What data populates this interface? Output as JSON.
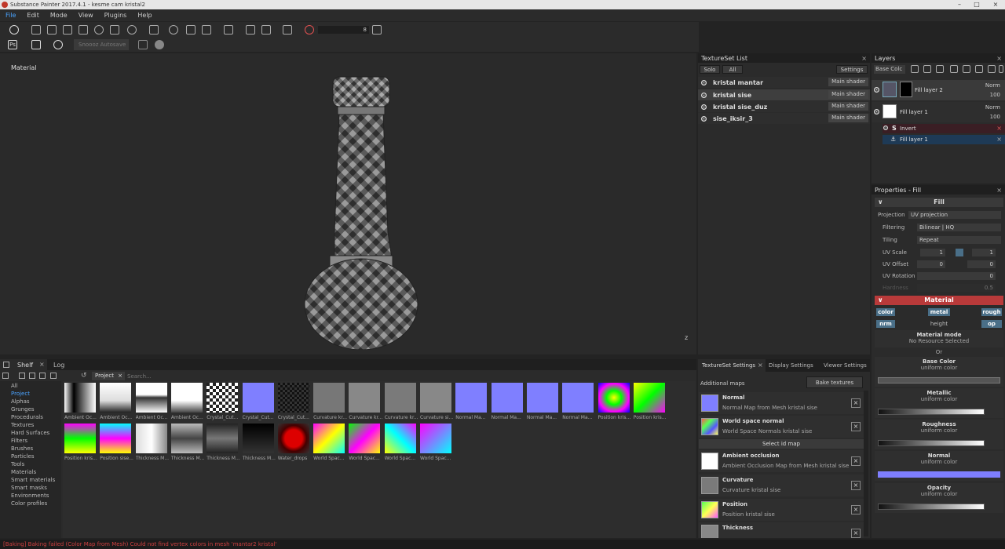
{
  "window": {
    "title": "Substance Painter 2017.4.1 - kesme cam kristal2"
  },
  "menu": [
    "File",
    "Edit",
    "Mode",
    "View",
    "Plugins",
    "Help"
  ],
  "toolbar": {
    "brush_size": "8",
    "autosave": "Snoooz Autosave"
  },
  "viewport": {
    "label": "Material",
    "axis_label": "z"
  },
  "textureset_list": {
    "title": "TextureSet List",
    "solo": "Solo",
    "all": "All",
    "settings": "Settings",
    "items": [
      {
        "name": "kristal mantar",
        "shader": "Main shader"
      },
      {
        "name": "kristal sise",
        "shader": "Main shader"
      },
      {
        "name": "kristal sise_duz",
        "shader": "Main shader"
      },
      {
        "name": "sise_iksir_3",
        "shader": "Main shader"
      }
    ]
  },
  "layers": {
    "title": "Layers",
    "channel": "Base Colc",
    "items": [
      {
        "name": "Fill layer 2",
        "blend": "Norm",
        "opacity": "100"
      },
      {
        "name": "Fill layer 1",
        "blend": "Norm",
        "opacity": "100"
      }
    ],
    "mask_items": [
      {
        "name": "Invert"
      },
      {
        "name": "Fill layer 1"
      }
    ]
  },
  "properties": {
    "title": "Properties - Fill",
    "fill_title": "Fill",
    "projection_label": "Projection",
    "projection_value": "UV projection",
    "filtering_label": "Filtering",
    "filtering_value": "Bilinear | HQ",
    "tiling_label": "Tiling",
    "tiling_value": "Repeat",
    "uvscale_label": "UV Scale",
    "uvscale_a": "1",
    "uvscale_b": "1",
    "uvoffset_label": "UV Offset",
    "uvoffset_a": "0",
    "uvoffset_b": "0",
    "uvrotation_label": "UV Rotation",
    "uvrotation_value": "0",
    "hardness_label": "Hardness",
    "hardness_value": "0.5",
    "material_title": "Material",
    "channels": [
      "color",
      "metal",
      "rough",
      "nrm",
      "height",
      "op"
    ],
    "material_mode": "Material mode",
    "no_resource": "No Resource Selected",
    "or": "Or",
    "blocks": [
      {
        "title": "Base Color",
        "sub": "uniform color"
      },
      {
        "title": "Metallic",
        "sub": "uniform color"
      },
      {
        "title": "Roughness",
        "sub": "uniform color"
      },
      {
        "title": "Normal",
        "sub": "uniform color"
      },
      {
        "title": "Opacity",
        "sub": "uniform color"
      }
    ],
    "normal_color": "#7f7fff"
  },
  "shelf": {
    "tabs": [
      "Shelf",
      "Log"
    ],
    "filter": "Project",
    "search_placeholder": "Search...",
    "categories": [
      "All",
      "Project",
      "Alphas",
      "Grunges",
      "Procedurals",
      "Textures",
      "Hard Surfaces",
      "Filters",
      "Brushes",
      "Particles",
      "Tools",
      "Materials",
      "Smart materials",
      "Smart masks",
      "Environments",
      "Color profiles"
    ],
    "row1": [
      "Ambient Oc...",
      "Ambient Oc...",
      "Ambient Oc...",
      "Ambient Oc...",
      "Crystal_Cut...",
      "Crystal_Cut...",
      "Crystal_Cut...",
      "Curvature kr...",
      "Curvature kr...",
      "Curvature kr...",
      "Curvature si...",
      "Normal Ma...",
      "Normal Ma...",
      "Normal Ma...",
      "Normal Ma...",
      "Position kris...",
      "Position kris..."
    ],
    "row2": [
      "Position kris...",
      "Position sise...",
      "Thickness M...",
      "Thickness M...",
      "Thickness M...",
      "Thickness M...",
      "Water_drops",
      "World Spac...",
      "World Spac...",
      "World Spac...",
      "World Spac..."
    ]
  },
  "textureset_settings": {
    "tabs": [
      "TextureSet Settings",
      "Display Settings",
      "Viewer Settings"
    ],
    "additional_maps": "Additional maps",
    "bake": "Bake textures",
    "select_id": "Select id map",
    "maps": [
      {
        "name": "Normal",
        "desc": "Normal Map from Mesh kristal sise"
      },
      {
        "name": "World space normal",
        "desc": "World Space Normals kristal sise"
      },
      {
        "name": "Ambient occlusion",
        "desc": "Ambient Occlusion Map from Mesh kristal sise"
      },
      {
        "name": "Curvature",
        "desc": "Curvature kristal sise"
      },
      {
        "name": "Position",
        "desc": "Position kristal sise"
      },
      {
        "name": "Thickness",
        "desc": ""
      }
    ]
  },
  "status": "[Baking] Baking failed (Color Map from Mesh) Could not find vertex colors in mesh 'mantar2 kristal'"
}
